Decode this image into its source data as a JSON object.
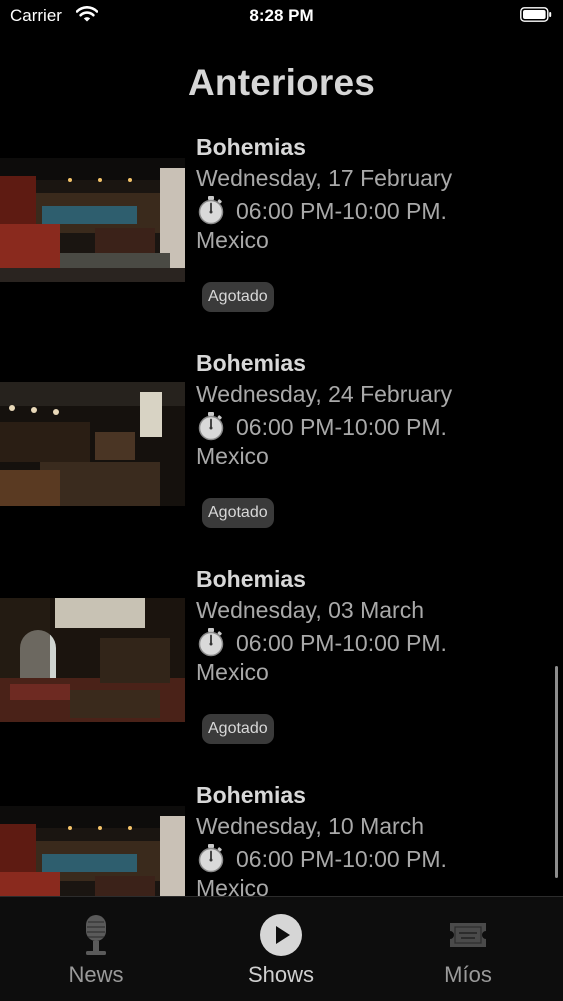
{
  "status_bar": {
    "carrier": "Carrier",
    "time": "8:28 PM"
  },
  "page": {
    "title": "Anteriores"
  },
  "events": [
    {
      "name": "Bohemias",
      "date": "Wednesday, 17 February",
      "time": "06:00 PM-10:00 PM.",
      "location": "Mexico",
      "badge": "Agotado",
      "photo": "restaurant-photo"
    },
    {
      "name": "Bohemias",
      "date": "Wednesday, 24 February",
      "time": "06:00 PM-10:00 PM.",
      "location": "Mexico",
      "badge": "Agotado",
      "photo": "restaurant-photo"
    },
    {
      "name": "Bohemias",
      "date": "Wednesday, 03 March",
      "time": "06:00 PM-10:00 PM.",
      "location": "Mexico",
      "badge": "Agotado",
      "photo": "restaurant-photo"
    },
    {
      "name": "Bohemias",
      "date": "Wednesday, 10 March",
      "time": "06:00 PM-10:00 PM.",
      "location": "Mexico",
      "photo": "restaurant-photo"
    }
  ],
  "tab_bar": {
    "tabs": [
      {
        "label": "News",
        "icon": "microphone-icon"
      },
      {
        "label": "Shows",
        "icon": "play-icon",
        "active": true
      },
      {
        "label": "Míos",
        "icon": "ticket-icon"
      }
    ]
  },
  "colors": {
    "background": "#000000",
    "text_primary": "#d8d8d8",
    "text_secondary": "#a9a9a9",
    "badge_bg": "#3a3a3a",
    "tab_bar_bg": "#0d0d0d"
  }
}
